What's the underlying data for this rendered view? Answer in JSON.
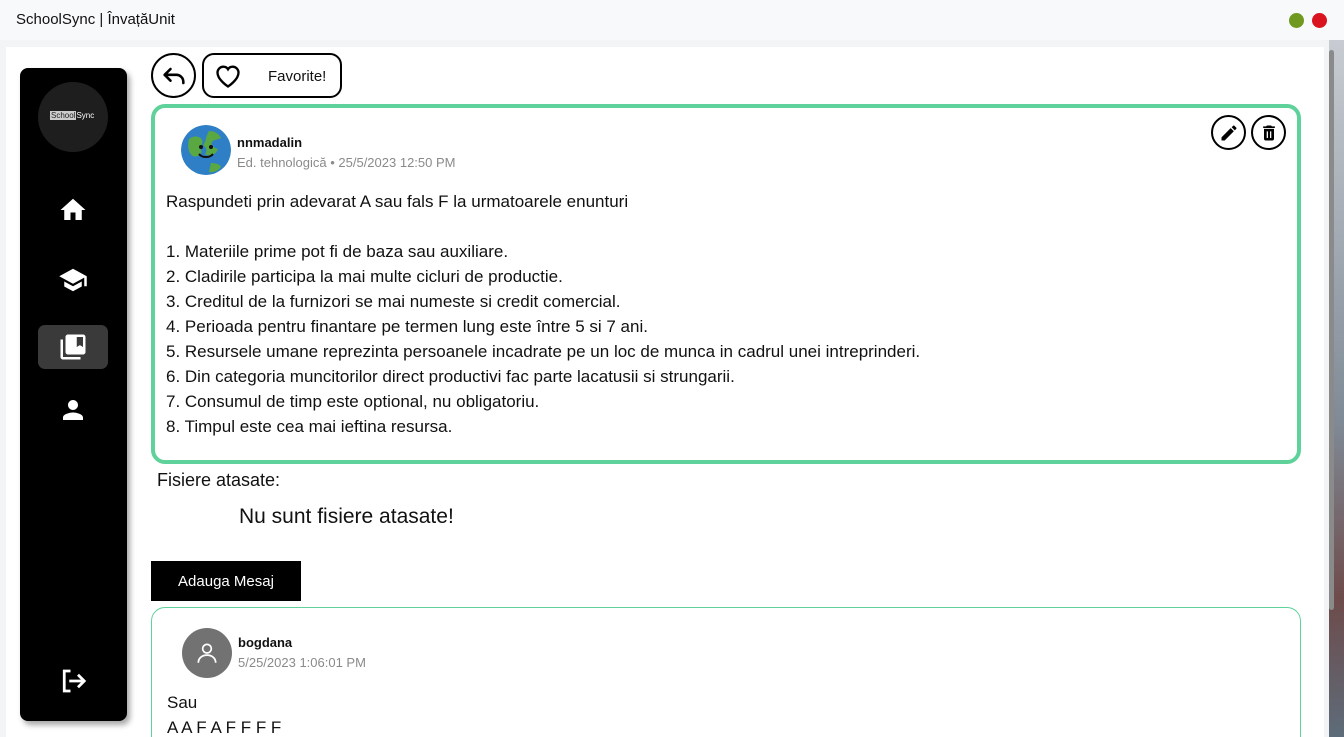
{
  "window": {
    "title": "SchoolSync | ÎnvațăUnit"
  },
  "sidebar": {
    "logo_prefix": "School",
    "logo_suffix": "Sync",
    "items": [
      {
        "icon": "home-icon",
        "active": false
      },
      {
        "icon": "graduation-cap-icon",
        "active": false
      },
      {
        "icon": "library-books-icon",
        "active": true
      },
      {
        "icon": "person-icon",
        "active": false
      }
    ],
    "logout_icon": "logout-icon"
  },
  "toolbar": {
    "back_icon": "back-arrow-icon",
    "favorite_label": "Favorite!"
  },
  "post": {
    "author": "nnmadalin",
    "meta": "Ed. tehnologică • 25/5/2023 12:50 PM",
    "lines": [
      "Raspundeti prin adevarat A sau fals F la urmatoarele enunturi",
      "",
      "1. Materiile prime pot fi de baza sau auxiliare.",
      "2. Cladirile participa la mai multe cicluri de productie.",
      "3. Creditul de la furnizori se mai numeste si credit comercial.",
      "4. Perioada pentru finantare pe termen lung este între 5 si 7 ani.",
      "5. Resursele umane reprezinta persoanele incadrate pe un loc de munca in cadrul unei intreprinderi.",
      "6. Din categoria muncitorilor direct productivi fac parte lacatusii si strungarii.",
      "7. Consumul de timp este optional, nu obligatoriu.",
      "8. Timpul este cea mai ieftina resursa."
    ]
  },
  "attachments": {
    "title": "Fisiere atasate:",
    "empty_text": "Nu sunt fisiere atasate!"
  },
  "add_message_label": "Adauga Mesaj",
  "messages": [
    {
      "author": "bogdana",
      "timestamp": "5/25/2023 1:06:01 PM",
      "lines": [
        "Sau",
        "A A F A F F F F"
      ]
    }
  ],
  "colors": {
    "accent": "#5fd19a",
    "sidebar": "#000000",
    "close_dot": "#d9141e",
    "maximize_dot": "#6f9a1f"
  }
}
